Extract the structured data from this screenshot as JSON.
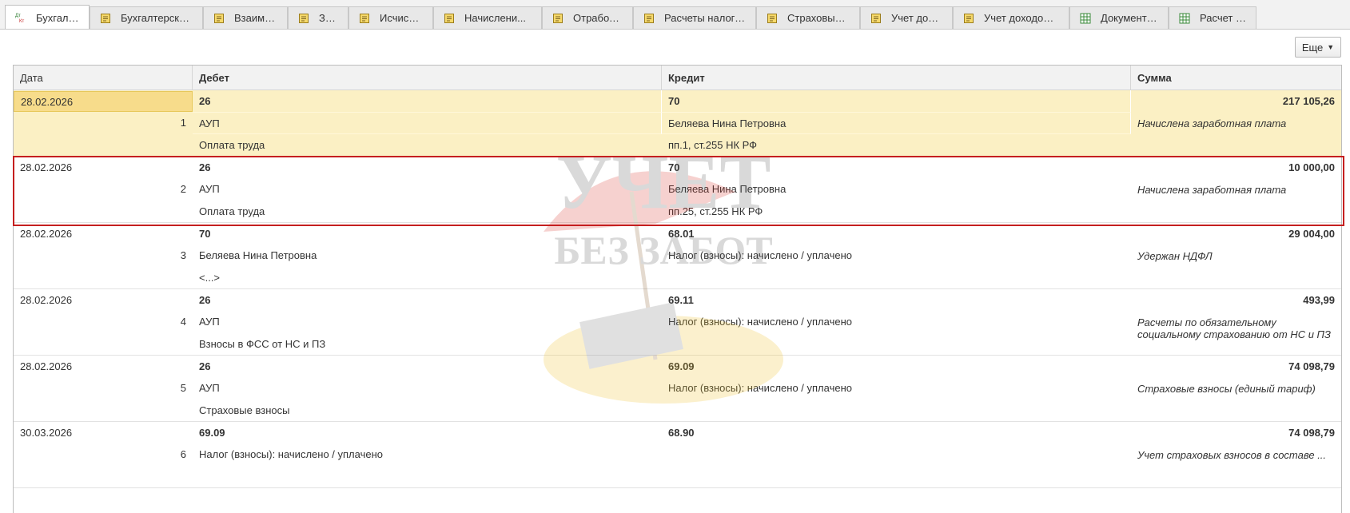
{
  "tabs": [
    {
      "label": "Бухгалт...",
      "icon": "dt-kt-icon",
      "active": true
    },
    {
      "label": "Бухгалтерски...",
      "icon": "document-icon"
    },
    {
      "label": "Взаимо...",
      "icon": "document-icon"
    },
    {
      "label": "За...",
      "icon": "document-icon"
    },
    {
      "label": "Исчисл...",
      "icon": "document-icon"
    },
    {
      "label": "Начислени...",
      "icon": "document-icon"
    },
    {
      "label": "Отработа...",
      "icon": "document-icon"
    },
    {
      "label": "Расчеты налого...",
      "icon": "document-icon"
    },
    {
      "label": "Страховые ...",
      "icon": "document-icon"
    },
    {
      "label": "Учет дохо...",
      "icon": "document-icon"
    },
    {
      "label": "Учет доходов д...",
      "icon": "document-icon"
    },
    {
      "label": "Документы ...",
      "icon": "table-icon"
    },
    {
      "label": "Расчет на...",
      "icon": "table-icon"
    }
  ],
  "toolbar": {
    "more_label": "Еще",
    "more_caret": "▼"
  },
  "grid": {
    "headers": {
      "date": "Дата",
      "debit": "Дебет",
      "credit": "Кредит",
      "sum": "Сумма"
    },
    "records": [
      {
        "date": "28.02.2026",
        "num": "1",
        "debit_account": "26",
        "debit_sub1": "АУП",
        "debit_sub2": "Оплата труда",
        "credit_account": "70",
        "credit_sub1": "Беляева Нина Петровна",
        "credit_sub2": "пп.1, ст.255 НК РФ",
        "sum": "217 105,26",
        "comment": "Начислена заработная плата",
        "selected": true
      },
      {
        "date": "28.02.2026",
        "num": "2",
        "debit_account": "26",
        "debit_sub1": "АУП",
        "debit_sub2": "Оплата труда",
        "credit_account": "70",
        "credit_sub1": "Беляева Нина Петровна",
        "credit_sub2": "пп.25, ст.255 НК РФ",
        "sum": "10 000,00",
        "comment": "Начислена заработная плата"
      },
      {
        "date": "28.02.2026",
        "num": "3",
        "debit_account": "70",
        "debit_sub1": "Беляева Нина Петровна",
        "debit_sub2": "<...>",
        "credit_account": "68.01",
        "credit_sub1": "Налог (взносы): начислено / уплачено",
        "credit_sub2": "",
        "sum": "29 004,00",
        "comment": "Удержан НДФЛ"
      },
      {
        "date": "28.02.2026",
        "num": "4",
        "debit_account": "26",
        "debit_sub1": "АУП",
        "debit_sub2": "Взносы в ФСС от НС и ПЗ",
        "credit_account": "69.11",
        "credit_sub1": "Налог (взносы): начислено / уплачено",
        "credit_sub2": "",
        "sum": "493,99",
        "comment": "Расчеты по обязательному социальному страхованию от НС и ПЗ"
      },
      {
        "date": "28.02.2026",
        "num": "5",
        "debit_account": "26",
        "debit_sub1": "АУП",
        "debit_sub2": "Страховые взносы",
        "credit_account": "69.09",
        "credit_sub1": "Налог (взносы): начислено / уплачено",
        "credit_sub2": "",
        "sum": "74 098,79",
        "comment": "Страховые взносы (единый тариф)"
      },
      {
        "date": "30.03.2026",
        "num": "6",
        "debit_account": "69.09",
        "debit_sub1": "Налог (взносы): начислено / уплачено",
        "debit_sub2": "",
        "credit_account": "68.90",
        "credit_sub1": "",
        "credit_sub2": "",
        "sum": "74 098,79",
        "comment": "Учет страховых взносов в составе ..."
      }
    ]
  },
  "watermark": {
    "line1": "УЧЕТ",
    "line2": "БЕЗ ЗАБОТ"
  },
  "colors": {
    "selected_row": "#fbf0c4",
    "highlight_border": "#c51f1f"
  }
}
